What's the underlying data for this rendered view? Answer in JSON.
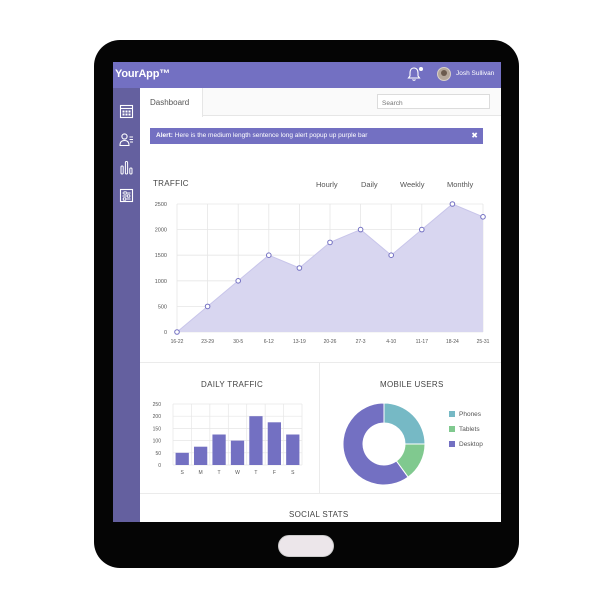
{
  "app": {
    "logo": "YourApp™",
    "user_name": "Josh Sullivan"
  },
  "tabs": {
    "dashboard": "Dashboard"
  },
  "search": {
    "placeholder": "Search"
  },
  "alert": {
    "label": "Alert:",
    "message": "Here is the medium length sentence long alert popup up purple bar",
    "close": "✖"
  },
  "traffic": {
    "title": "TRAFFIC",
    "periods": [
      "Hourly",
      "Daily",
      "Weekly",
      "Monthly"
    ]
  },
  "daily_traffic": {
    "title": "DAILY TRAFFIC"
  },
  "mobile_users": {
    "title": "MOBILE USERS"
  },
  "social_stats": {
    "title": "SOCIAL STATS"
  },
  "sidebar": {
    "items": [
      "calendar-icon",
      "users-icon",
      "chart-icon",
      "settings-icon"
    ]
  },
  "colors": {
    "accent": "#7370c2",
    "sidebar": "#64609f",
    "fill": "#d8d6f0",
    "phones": "#76b9c5",
    "tablets": "#80c98f",
    "desktop": "#7370c2"
  },
  "chart_data": [
    {
      "type": "area",
      "title": "TRAFFIC",
      "categories": [
        "16-22",
        "23-29",
        "30-5",
        "6-12",
        "13-19",
        "20-26",
        "27-3",
        "4-10",
        "11-17",
        "18-24",
        "25-31"
      ],
      "values": [
        0,
        500,
        1000,
        1500,
        1250,
        1750,
        2000,
        1500,
        2000,
        2500,
        2250
      ],
      "yticks": [
        "0",
        "500",
        "1000",
        "1500",
        "2000",
        "2500"
      ],
      "ylim": [
        0,
        2500
      ],
      "grid": true
    },
    {
      "type": "bar",
      "title": "DAILY TRAFFIC",
      "categories": [
        "S",
        "M",
        "T",
        "W",
        "T",
        "F",
        "S"
      ],
      "values": [
        50,
        75,
        125,
        100,
        200,
        175,
        125
      ],
      "yticks": [
        "0",
        "50",
        "100",
        "150",
        "200",
        "250"
      ],
      "ylim": [
        0,
        250
      ],
      "grid": true
    },
    {
      "type": "pie",
      "title": "MOBILE USERS",
      "labels": [
        "Phones",
        "Tablets",
        "Desktop"
      ],
      "values": [
        25,
        15,
        60
      ],
      "legend": "right"
    }
  ]
}
